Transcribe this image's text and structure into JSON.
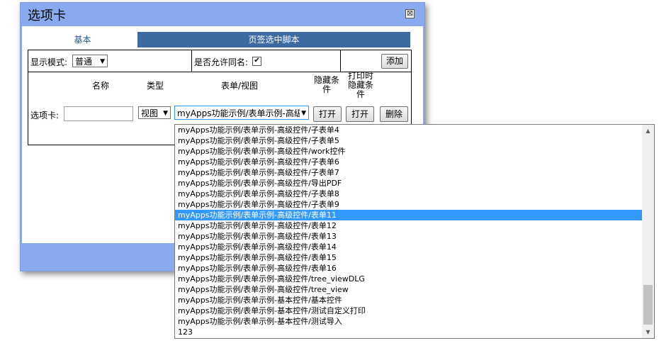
{
  "dialog": {
    "title": "选项卡",
    "close_glyph": "⊠"
  },
  "tabs": [
    {
      "label": "基本"
    },
    {
      "label": "页签选中脚本"
    }
  ],
  "form": {
    "display_mode_label": "显示模式:",
    "display_mode_value": "普通",
    "allow_same_name_label": "是否允许同名:",
    "allow_same_name_checked": "✔",
    "add_button": "添加",
    "headers": {
      "name": "名称",
      "type": "类型",
      "form_view": "表单/视图",
      "hide_condition": "隐藏条件",
      "print_hide_condition": "打印时隐藏条件"
    },
    "row_label": "选项卡:",
    "name_value": "",
    "type_value": "视图",
    "form_value": "myApps功能示例/表单示例-高级",
    "open_button_1": "打开",
    "open_button_2": "打开",
    "delete_button": "删除"
  },
  "dropdown": {
    "options": [
      "myApps功能示例/表单示例-高级控件/子表单4",
      "myApps功能示例/表单示例-高级控件/子表单5",
      "myApps功能示例/表单示例-高级控件/work控件",
      "myApps功能示例/表单示例-高级控件/子表单6",
      "myApps功能示例/表单示例-高级控件/子表单7",
      "myApps功能示例/表单示例-高级控件/导出PDF",
      "myApps功能示例/表单示例-高级控件/子表单8",
      "myApps功能示例/表单示例-高级控件/子表单9",
      "myApps功能示例/表单示例-高级控件/表单11",
      "myApps功能示例/表单示例-高级控件/表单12",
      "myApps功能示例/表单示例-高级控件/表单13",
      "myApps功能示例/表单示例-高级控件/表单14",
      "myApps功能示例/表单示例-高级控件/表单15",
      "myApps功能示例/表单示例-高级控件/表单16",
      "myApps功能示例/表单示例-高级控件/tree_viewDLG",
      "myApps功能示例/表单示例-高级控件/tree_view",
      "myApps功能示例/表单示例-基本控件/基本控件",
      "myApps功能示例/表单示例-基本控件/测试自定义打印",
      "myApps功能示例/表单示例-基本控件/测试导入",
      "123"
    ],
    "selected_index": 8
  },
  "colors": {
    "dialog_bg": "#8aaaf0",
    "tab_active": "#3d6aa0",
    "selection": "#3399ff"
  }
}
